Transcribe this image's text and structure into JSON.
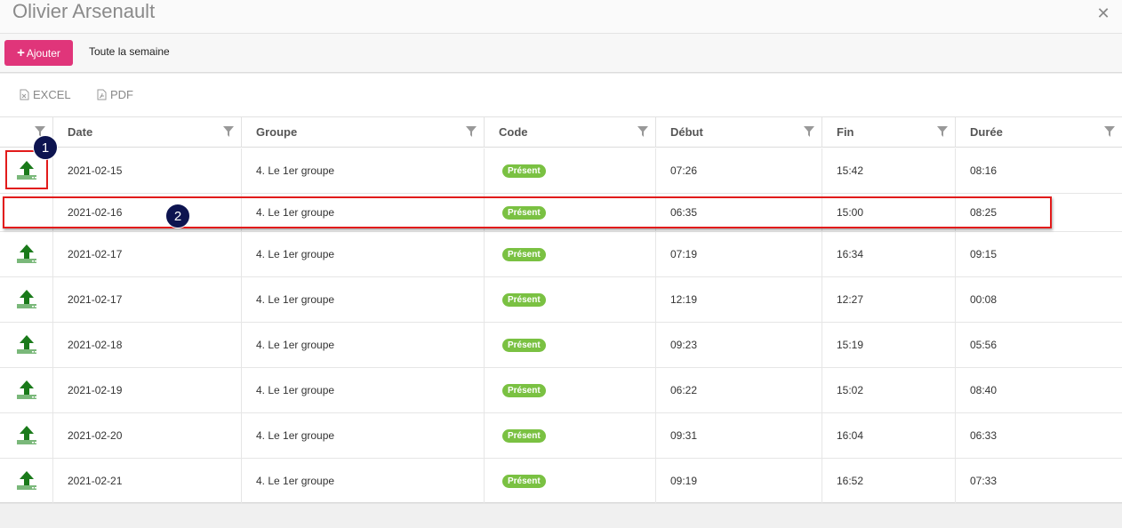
{
  "dialog": {
    "title": "Olivier Arsenault",
    "close_symbol": "✕"
  },
  "toolbar": {
    "add_label": "Ajouter",
    "add_plus": "+",
    "week_label": "Toute la semaine",
    "add_color": "#e0357a"
  },
  "export": {
    "excel_label": "EXCEL",
    "pdf_label": "PDF"
  },
  "grid": {
    "columns": [
      "",
      "Date",
      "Groupe",
      "Code",
      "Début",
      "Fin",
      "Durée"
    ],
    "rows": [
      {
        "has_icon": true,
        "date": "2021-02-15",
        "group": "4. Le 1er groupe",
        "code": "Présent",
        "start": "07:26",
        "end": "15:42",
        "duration": "08:16"
      },
      {
        "has_icon": false,
        "date": "2021-02-16",
        "group": "4. Le 1er groupe",
        "code": "Présent",
        "start": "06:35",
        "end": "15:00",
        "duration": "08:25"
      },
      {
        "has_icon": true,
        "date": "2021-02-17",
        "group": "4. Le 1er groupe",
        "code": "Présent",
        "start": "07:19",
        "end": "16:34",
        "duration": "09:15"
      },
      {
        "has_icon": true,
        "date": "2021-02-17",
        "group": "4. Le 1er groupe",
        "code": "Présent",
        "start": "12:19",
        "end": "12:27",
        "duration": "00:08"
      },
      {
        "has_icon": true,
        "date": "2021-02-18",
        "group": "4. Le 1er groupe",
        "code": "Présent",
        "start": "09:23",
        "end": "15:19",
        "duration": "05:56"
      },
      {
        "has_icon": true,
        "date": "2021-02-19",
        "group": "4. Le 1er groupe",
        "code": "Présent",
        "start": "06:22",
        "end": "15:02",
        "duration": "08:40"
      },
      {
        "has_icon": true,
        "date": "2021-02-20",
        "group": "4. Le 1er groupe",
        "code": "Présent",
        "start": "09:31",
        "end": "16:04",
        "duration": "06:33"
      },
      {
        "has_icon": true,
        "date": "2021-02-21",
        "group": "4. Le 1er groupe",
        "code": "Présent",
        "start": "09:19",
        "end": "16:52",
        "duration": "07:33"
      }
    ],
    "badge_color": "#7ac142",
    "row_icon": "upload-arrow-icon"
  },
  "annotations": {
    "marker1": "1",
    "marker2": "2",
    "highlight_color": "#e21b1b"
  }
}
